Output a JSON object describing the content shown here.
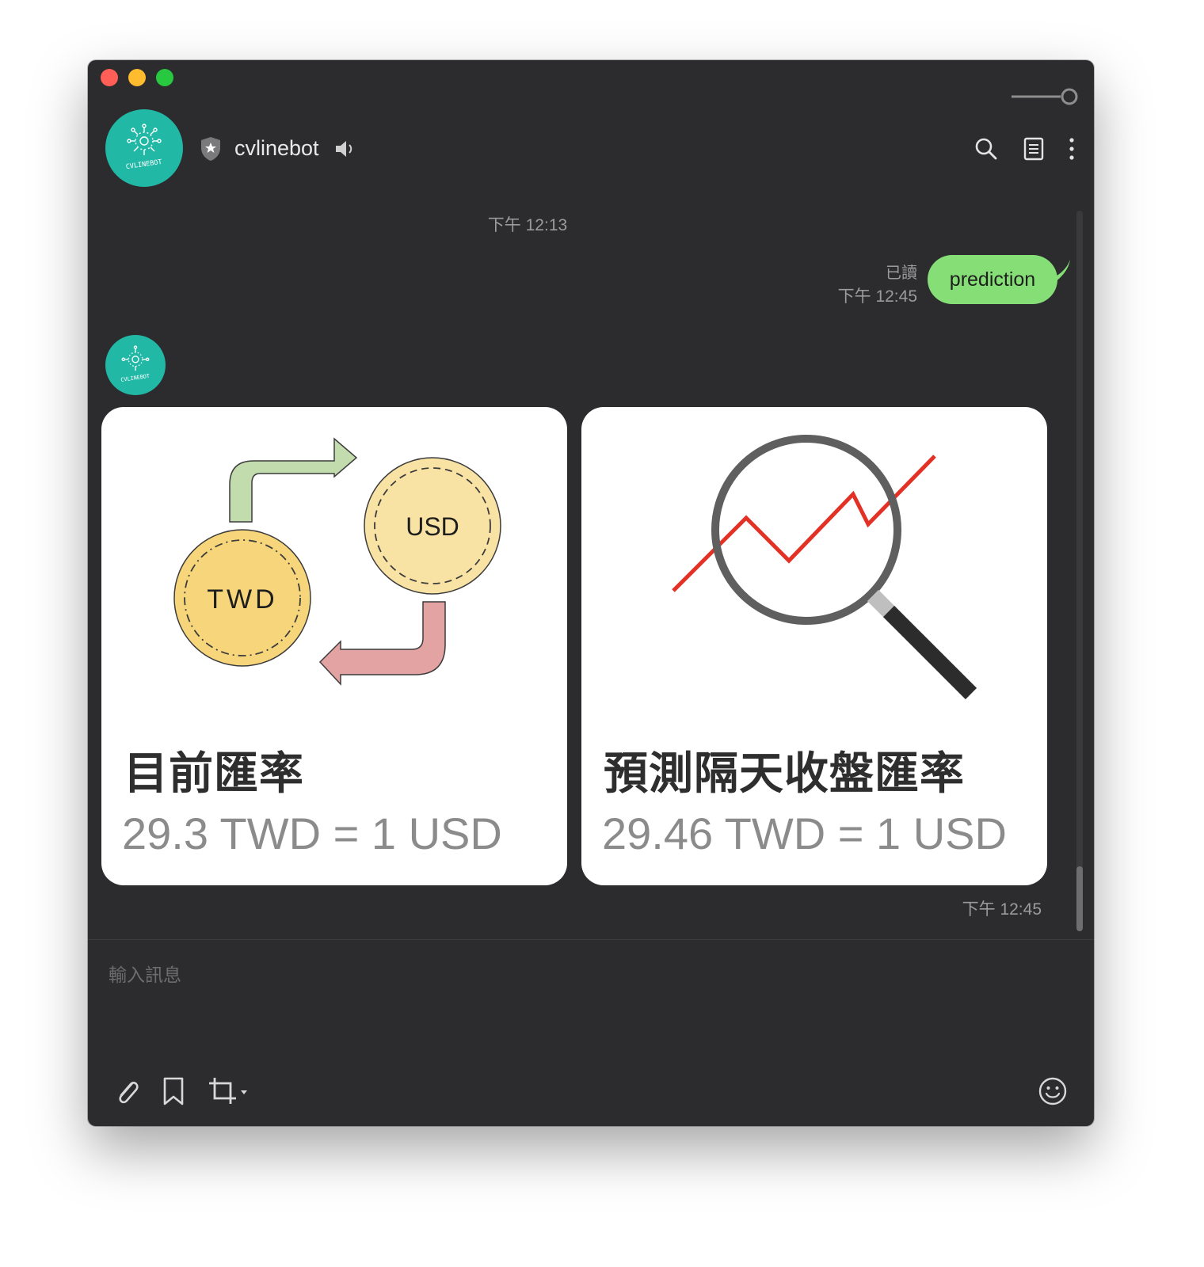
{
  "chat": {
    "name": "cvlinebot",
    "avatar_text": "CVLINEBOT",
    "date_separator": "下午 12:13"
  },
  "sent": {
    "text": "prediction",
    "read_label": "已讀",
    "time": "下午 12:45"
  },
  "cards": [
    {
      "title": "目前匯率",
      "value": "29.3 TWD = 1 USD",
      "coin_labels": [
        "TWD",
        "USD"
      ]
    },
    {
      "title": "預測隔天收盤匯率",
      "value": "29.46 TWD = 1 USD"
    }
  ],
  "received_time": "下午 12:45",
  "composer": {
    "placeholder": "輸入訊息"
  },
  "icons": {
    "header": [
      "shield-star-icon",
      "speaker-icon",
      "search-icon",
      "notes-icon",
      "more-icon"
    ],
    "toolbar": [
      "attach-icon",
      "bookmark-icon",
      "crop-icon",
      "emoji-icon"
    ]
  },
  "colors": {
    "window_bg": "#2c2c2e",
    "bubble_green": "#85df76",
    "avatar_teal": "#21b8a6",
    "chart_red": "#e33125"
  }
}
